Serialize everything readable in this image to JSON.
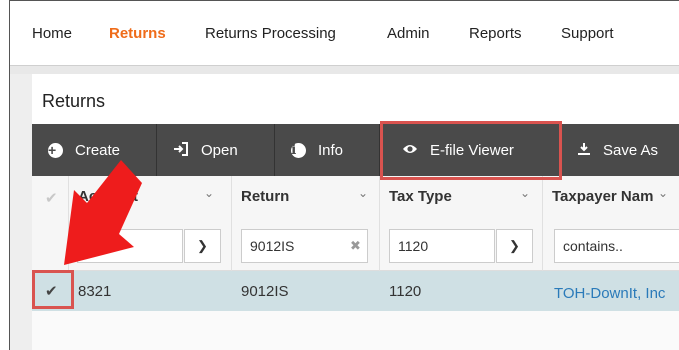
{
  "nav": {
    "items": [
      "Home",
      "Returns",
      "Returns Processing",
      "Admin",
      "Reports",
      "Support"
    ],
    "active": "Returns"
  },
  "page": {
    "title": "Returns"
  },
  "toolbar": {
    "create": "Create",
    "open": "Open",
    "info": "Info",
    "efile_viewer": "E-file Viewer",
    "save_as": "Save As"
  },
  "grid": {
    "headers": {
      "account": "Account",
      "return": "Return",
      "tax_type": "Tax Type",
      "taxpayer_name": "Taxpayer Nam"
    },
    "filters": {
      "account": "",
      "return": "9012IS",
      "tax_type": "1120",
      "taxpayer_name": "contains.."
    },
    "rows": [
      {
        "account": "8321",
        "return": "9012IS",
        "tax_type": "1120",
        "taxpayer_name": "TOH-DownIt, Inc"
      }
    ]
  },
  "colors": {
    "active_nav": "#ef6c1a",
    "toolbar_bg": "#4a4a4a",
    "selected_row": "#cfe0e4",
    "highlight": "#d9534f",
    "link": "#2a7ab9",
    "annotation_arrow": "#ee1c1c"
  },
  "icons": {
    "create": "plus-circle-icon",
    "open": "sign-in-icon",
    "info": "info-circle-icon",
    "efile_viewer": "eye-icon",
    "save_as": "download-icon"
  }
}
